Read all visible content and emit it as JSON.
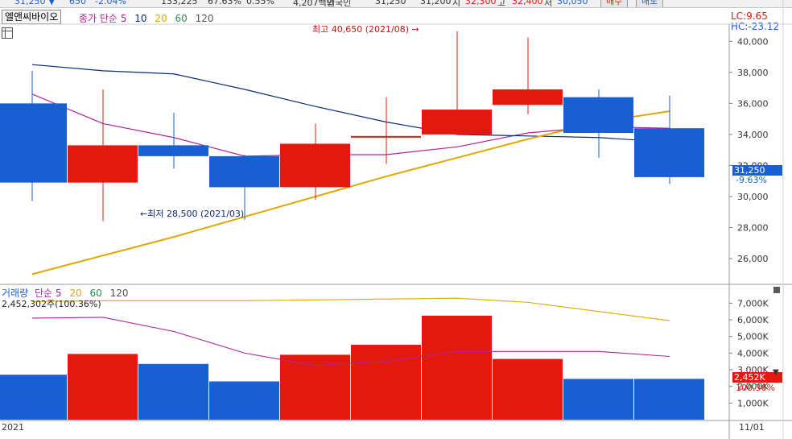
{
  "top_strip": {
    "price": "31,250 ▼",
    "change": "650",
    "change_pct": "-2.04%",
    "volume": "133,225",
    "ratio": "67.63%",
    "turnover": "0.55%",
    "amount": "4,207백만",
    "label": "외국인",
    "v1": "31,250",
    "v2": "31,200",
    "mark_si": "시",
    "v3": "32,300",
    "mark_go": "고",
    "v4": "32,400",
    "mark_jeo": "저",
    "v5": "30,050",
    "buy_label": "매수",
    "sell_label": "매도"
  },
  "header": {
    "stock_name": "엘앤씨바이오",
    "legend_title": "종가 단순",
    "ma_periods": [
      "5",
      "10",
      "20",
      "60",
      "120"
    ]
  },
  "indicators": {
    "lc": "LC:9.65",
    "hc": "HC:-23.12"
  },
  "price_annotations": {
    "high": "최고 40,650 (2021/08)",
    "low": "최저 28,500 (2021/03)",
    "current_price": "31,250",
    "current_pct": "-9.63%"
  },
  "volume_panel": {
    "legend_title": "거래량",
    "legend_ma": "단순",
    "ma_periods": [
      "5",
      "20",
      "60",
      "120"
    ],
    "info": "2,452,302주(100.36%)",
    "current_volume": "2,452K",
    "current_pct": "100.36%"
  },
  "dates": {
    "left": "2021",
    "right": "11/01"
  },
  "colors": {
    "up": "#e3180e",
    "down": "#1a5fd1",
    "ma5": "#b0259b",
    "ma10": "#0b2a78",
    "ma20": "#e0a800",
    "ma60": "#2e8b57",
    "ma120": "#555555"
  },
  "chart_data": [
    {
      "type": "candlestick",
      "title": "",
      "ylim": [
        24500,
        41000
      ],
      "yticks": [
        26000,
        28000,
        30000,
        32000,
        34000,
        36000,
        38000,
        40000
      ],
      "ytick_labels": [
        "26,000",
        "28,000",
        "30,000",
        "32,000",
        "34,000",
        "36,000",
        "38,000",
        "40,000"
      ],
      "candles": [
        {
          "open": 36000,
          "close": 30900,
          "high": 38100,
          "low": 29700
        },
        {
          "open": 30900,
          "close": 33300,
          "high": 36900,
          "low": 28400
        },
        {
          "open": 33300,
          "close": 32600,
          "high": 35400,
          "low": 31800
        },
        {
          "open": 32600,
          "close": 30600,
          "high": 32700,
          "low": 28500
        },
        {
          "open": 30600,
          "close": 33400,
          "high": 34700,
          "low": 29800
        },
        {
          "open": 33800,
          "close": 33900,
          "high": 36400,
          "low": 32100
        },
        {
          "open": 34000,
          "close": 35600,
          "high": 40650,
          "low": 34000
        },
        {
          "open": 35900,
          "close": 36900,
          "high": 40250,
          "low": 35300
        },
        {
          "open": 36400,
          "close": 34100,
          "high": 36900,
          "low": 32500
        },
        {
          "open": 34400,
          "close": 31250,
          "high": 36500,
          "low": 30800
        }
      ],
      "series": [
        {
          "name": "5",
          "values": [
            36600,
            34700,
            33800,
            32600,
            32700,
            32700,
            33200,
            34100,
            34500,
            34400
          ]
        },
        {
          "name": "10",
          "values": [
            38500,
            38100,
            37900,
            36900,
            35800,
            34800,
            34000,
            33900,
            33800,
            33500
          ]
        },
        {
          "name": "20",
          "values": [
            25000,
            26200,
            27400,
            28700,
            30000,
            31300,
            32500,
            33700,
            34800,
            35500
          ]
        }
      ]
    },
    {
      "type": "bar",
      "title": "",
      "ylim": [
        0,
        7600
      ],
      "yticks": [
        1000,
        2000,
        3000,
        4000,
        5000,
        6000,
        7000
      ],
      "ytick_labels": [
        "1,000K",
        "2,000K",
        "3,000K",
        "4,000K",
        "5,000K",
        "6,000K",
        "7,000K"
      ],
      "values": [
        2700,
        3950,
        3350,
        2300,
        3900,
        4500,
        6250,
        3650,
        2450,
        2452
      ],
      "series": [
        {
          "name": "5",
          "values": [
            6100,
            6150,
            5300,
            4000,
            3250,
            3500,
            4100,
            4100,
            4100,
            3800
          ]
        },
        {
          "name": "20",
          "values": [
            7100,
            7150,
            7150,
            7150,
            7200,
            7250,
            7300,
            7050,
            6500,
            5950
          ]
        }
      ]
    }
  ]
}
